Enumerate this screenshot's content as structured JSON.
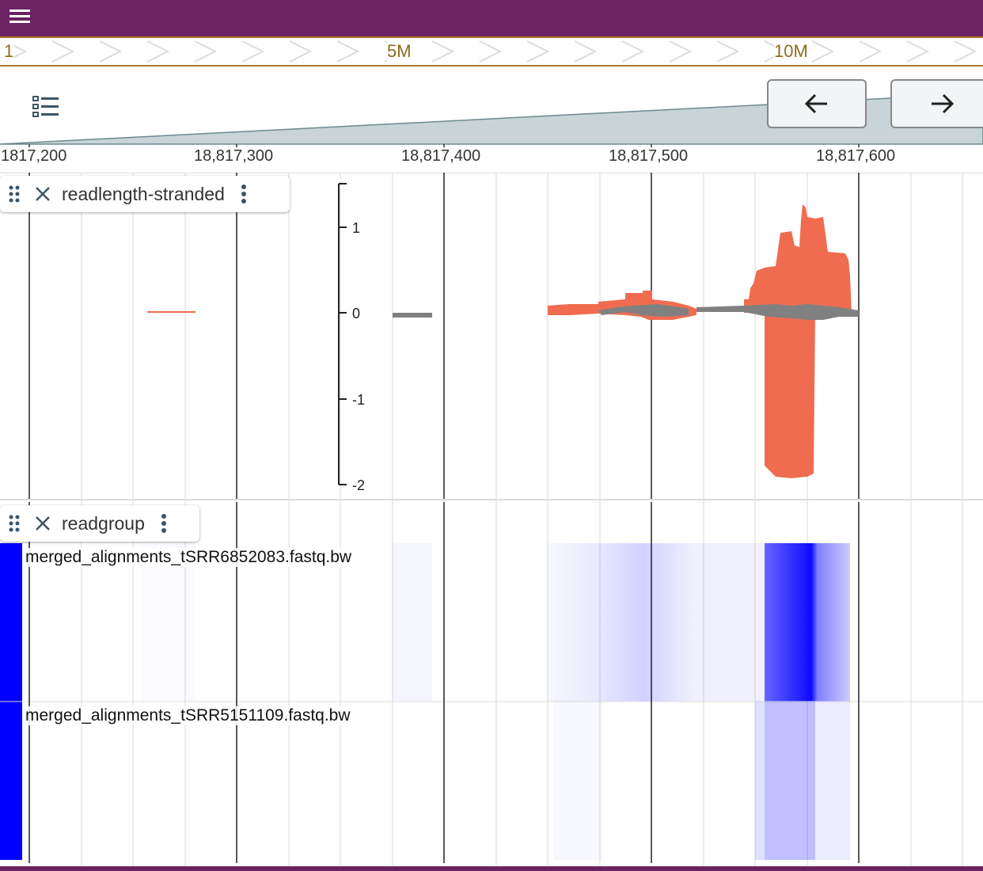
{
  "header": {
    "menu_icon": "hamburger-icon"
  },
  "overview": {
    "labels": [
      "1",
      "5M",
      "10M"
    ]
  },
  "navigation": {
    "back_icon": "arrow-left-icon",
    "forward_icon": "arrow-right-icon",
    "tracks_icon": "track-list-icon"
  },
  "ruler": {
    "labels": [
      "1817,200",
      "18,817,300",
      "18,817,400",
      "18,817,500",
      "18,817,600"
    ]
  },
  "tracks": [
    {
      "name": "readlength-stranded",
      "drag_icon": "drag-handle-icon",
      "close_icon": "close-icon",
      "menu_icon": "more-vertical-icon",
      "y_axis_ticks": [
        "1",
        "0",
        "-1",
        "-2"
      ]
    },
    {
      "name": "readgroup",
      "drag_icon": "drag-handle-icon",
      "close_icon": "close-icon",
      "menu_icon": "more-vertical-icon",
      "rows": [
        "merged_alignments_tSRR6852083.fastq.bw",
        "merged_alignments_tSRR5151109.fastq.bw"
      ]
    }
  ],
  "colors": {
    "header": "#6a2360",
    "overview_accent": "#a9762a",
    "positive_strand": "#ef6c50",
    "negative_strand": "#ef6c50",
    "mean_line": "#808080",
    "heatmap": "#0000ff"
  }
}
